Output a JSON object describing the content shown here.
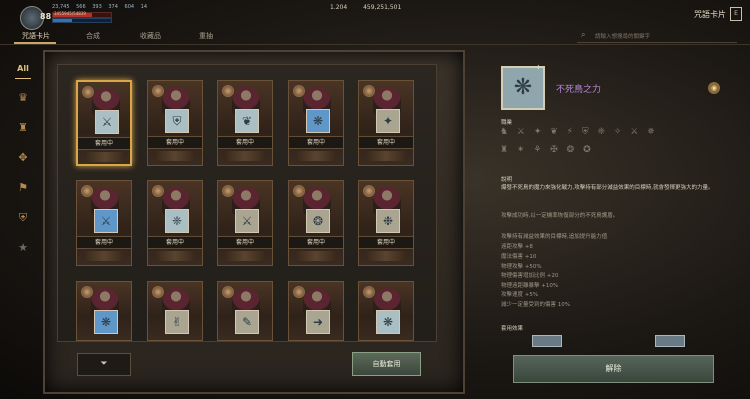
{
  "top": {
    "level": "88",
    "stats": [
      "23,745",
      "566",
      "393",
      "374",
      "604",
      "14"
    ],
    "hp": "3455945/54839",
    "hp_fill": 0.68,
    "mp_fill": 0.33,
    "currency": [
      "1.204",
      "459,251,501"
    ],
    "window_title": "咒語卡片",
    "close": "E"
  },
  "tabs": [
    "咒語卡片",
    "合成",
    "收藏品",
    "重抽"
  ],
  "search": {
    "placeholder": "請輸入想搜尋的關鍵字"
  },
  "categories": {
    "all": "All",
    "icons": [
      "crest-icon",
      "fire-crest-icon",
      "wing-crest-icon",
      "banner-icon",
      "shield-icon",
      "star-icon"
    ]
  },
  "cards": [
    {
      "label": "套用中",
      "emblem": "⚔",
      "tone": "light"
    },
    {
      "label": "套用中",
      "emblem": "⛨",
      "tone": "light"
    },
    {
      "label": "套用中",
      "emblem": "❦",
      "tone": "light"
    },
    {
      "label": "套用中",
      "emblem": "❋",
      "tone": "blue"
    },
    {
      "label": "套用中",
      "emblem": "✦",
      "tone": "tan"
    },
    {
      "label": "套用中",
      "emblem": "⚔",
      "tone": "blue"
    },
    {
      "label": "套用中",
      "emblem": "❈",
      "tone": "light"
    },
    {
      "label": "套用中",
      "emblem": "⚔",
      "tone": "tan"
    },
    {
      "label": "套用中",
      "emblem": "❂",
      "tone": "tan"
    },
    {
      "label": "套用中",
      "emblem": "❉",
      "tone": "tan"
    },
    {
      "label": "",
      "emblem": "❋",
      "tone": "blue"
    },
    {
      "label": "",
      "emblem": "✌",
      "tone": "tan"
    },
    {
      "label": "",
      "emblem": "✎",
      "tone": "tan"
    },
    {
      "label": "",
      "emblem": "➜",
      "tone": "tan"
    },
    {
      "label": "",
      "emblem": "❋",
      "tone": "light"
    }
  ],
  "buttons": {
    "filter": "⏷",
    "auto_apply": "自動套用",
    "remove": "解除"
  },
  "detail": {
    "name": "不死鳥之力",
    "emblem": "❋",
    "profession_label": "職業",
    "profession_row1": "♞ ⚔ ✦ ❦ ⚡ ⛨ ❈ ✧ ⚔ ✵",
    "profession_row2": "♜ ✶ ⚘ ✠ ❂ ✪",
    "desc_title": "說明",
    "desc1": "爆發不死鳥的魔力來強化戰力,攻擊持有部分減益效果的目標時,就會發揮更強大的力量。",
    "desc2": "攻擊成功時,以一定機率恢復部分的不死鳥護盾。",
    "desc3": "攻擊持有減益效果的目標時,追加提升能力值",
    "stats": [
      "遠距攻擊 +8",
      "魔法傷害 +10",
      "物理攻擊 +50%",
      "物理傷害增加比例 +20",
      "物理遠距離暴擊 +10%",
      "攻擊速度 +5%",
      "減少一定量受到的傷害 10%"
    ],
    "apply_effect_label": "套用效果"
  }
}
